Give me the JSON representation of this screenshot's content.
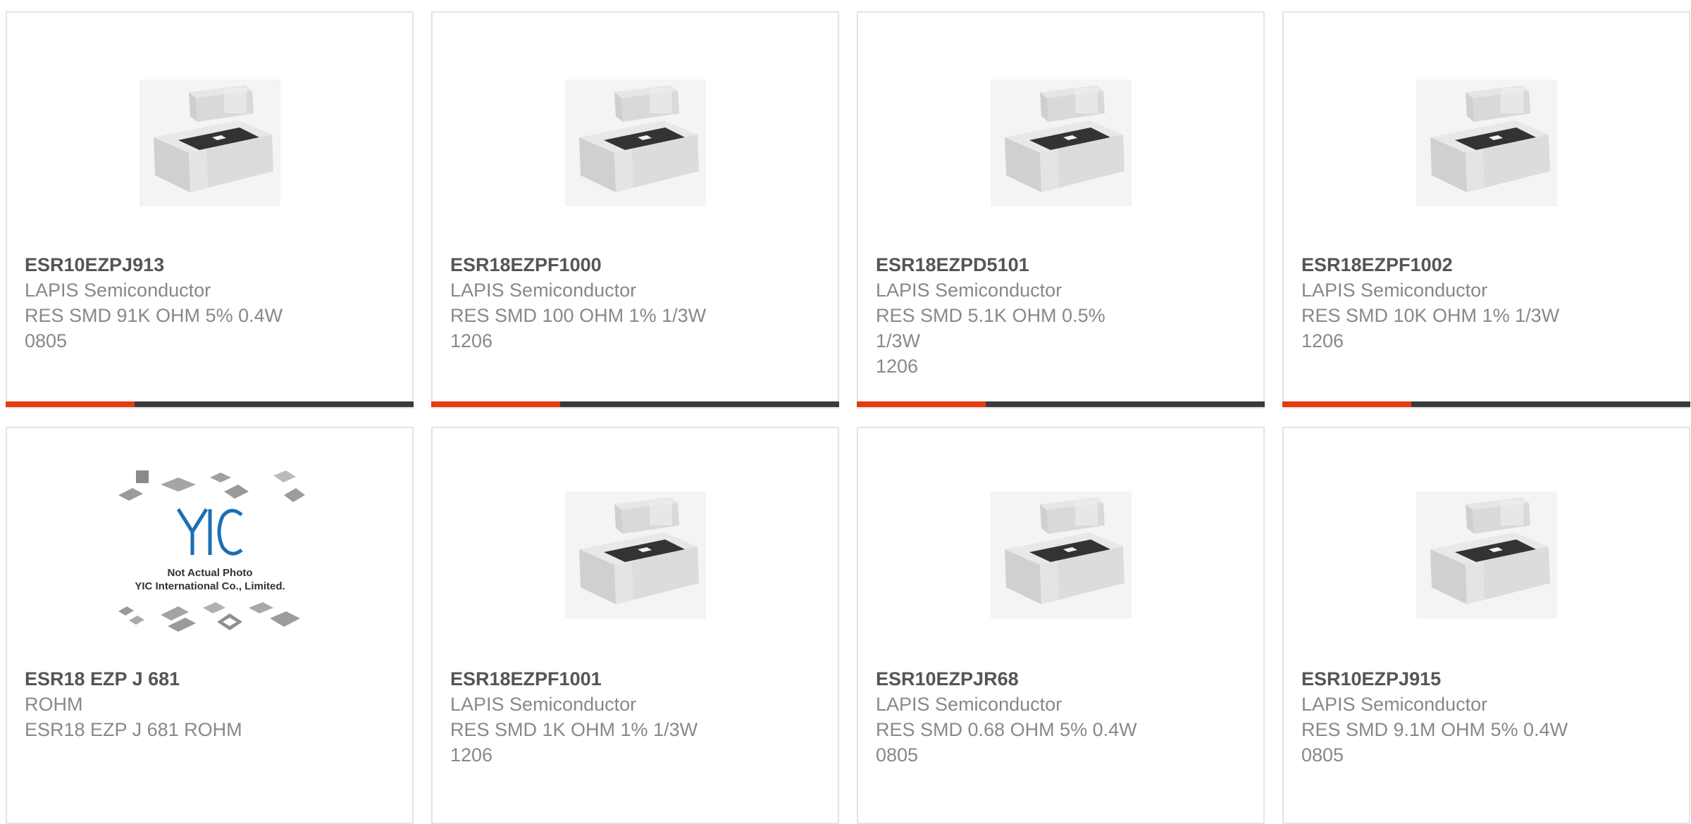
{
  "products": [
    {
      "part": "ESR10EZPJ913",
      "maker": "LAPIS Semiconductor",
      "desc": "RES SMD 91K OHM 5% 0.4W",
      "pkg": "0805",
      "image": "resistor-chip"
    },
    {
      "part": "ESR18EZPF1000",
      "maker": "LAPIS Semiconductor",
      "desc": "RES SMD 100 OHM 1% 1/3W",
      "pkg": "1206",
      "image": "resistor-chip"
    },
    {
      "part": "ESR18EZPD5101",
      "maker": "LAPIS Semiconductor",
      "desc": "RES SMD 5.1K OHM 0.5% 1/3W",
      "pkg": "1206",
      "image": "resistor-chip"
    },
    {
      "part": "ESR18EZPF1002",
      "maker": "LAPIS Semiconductor",
      "desc": "RES SMD 10K OHM 1% 1/3W",
      "pkg": "1206",
      "image": "resistor-chip"
    },
    {
      "part": "ESR18 EZP J 681",
      "maker": "ROHM",
      "desc": "ESR18 EZP J 681 ROHM",
      "pkg": "",
      "image": "not-actual-photo",
      "placeholder_line1": "Not Actual Photo",
      "placeholder_line2": "YIC International Co., Limited.",
      "logo_text": "YIC"
    },
    {
      "part": "ESR18EZPF1001",
      "maker": "LAPIS Semiconductor",
      "desc": "RES SMD 1K OHM 1% 1/3W",
      "pkg": "1206",
      "image": "resistor-chip"
    },
    {
      "part": "ESR10EZPJR68",
      "maker": "LAPIS Semiconductor",
      "desc": "RES SMD 0.68 OHM 5% 0.4W",
      "pkg": "0805",
      "image": "resistor-chip"
    },
    {
      "part": "ESR10EZPJ915",
      "maker": "LAPIS Semiconductor",
      "desc": "RES SMD 9.1M OHM 5% 0.4W",
      "pkg": "0805",
      "image": "resistor-chip"
    }
  ],
  "colors": {
    "accent": "#e83a0b",
    "bar": "#3a3a3a",
    "border": "#e4e4e4",
    "part_text": "#555555",
    "meta_text": "#888888"
  }
}
